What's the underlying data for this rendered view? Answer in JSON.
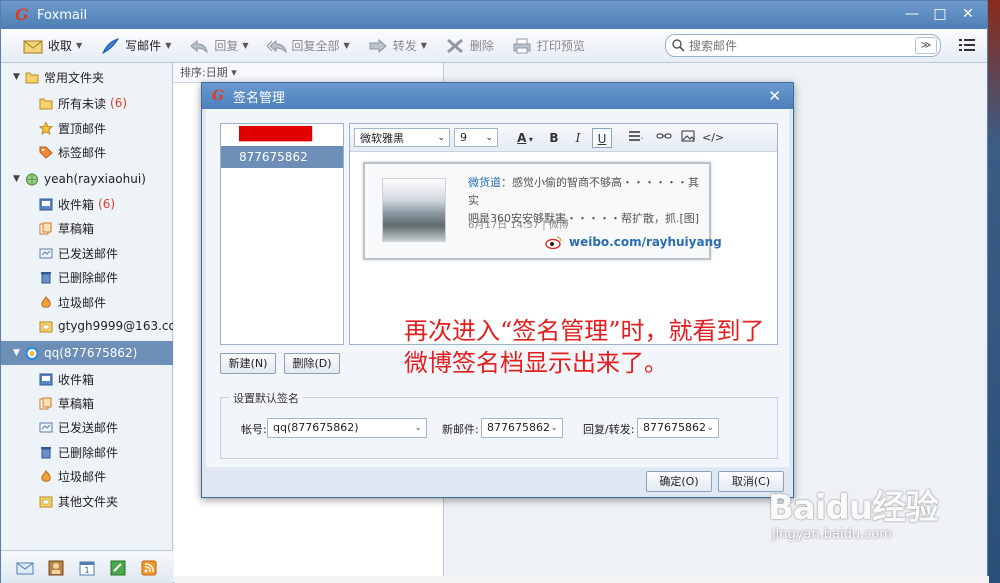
{
  "window": {
    "title": "Foxmail",
    "minimize": "—",
    "maximize": "□",
    "close": "✕"
  },
  "toolbar": {
    "receive": "收取",
    "compose": "写邮件",
    "reply": "回复",
    "reply_all": "回复全部",
    "forward": "转发",
    "delete": "删除",
    "print_preview": "打印预览",
    "search_placeholder": "搜索邮件",
    "search_dropdown": "≫"
  },
  "sidebar": {
    "favorites": {
      "label": "常用文件夹",
      "items": [
        {
          "label": "所有未读",
          "count": "(6)"
        },
        {
          "label": "置顶邮件",
          "count": ""
        },
        {
          "label": "标签邮件",
          "count": ""
        }
      ]
    },
    "account1": {
      "label": "yeah(rayxiaohui)",
      "items": [
        {
          "label": "收件箱",
          "count": "(6)"
        },
        {
          "label": "草稿箱",
          "count": ""
        },
        {
          "label": "已发送邮件",
          "count": ""
        },
        {
          "label": "已删除邮件",
          "count": ""
        },
        {
          "label": "垃圾邮件",
          "count": ""
        },
        {
          "label": "gtygh9999@163.co...",
          "count": ""
        }
      ]
    },
    "account2": {
      "label": "qq(877675862)",
      "items": [
        {
          "label": "收件箱"
        },
        {
          "label": "草稿箱"
        },
        {
          "label": "已发送邮件"
        },
        {
          "label": "已删除邮件"
        },
        {
          "label": "垃圾邮件"
        },
        {
          "label": "其他文件夹"
        }
      ]
    }
  },
  "list": {
    "sort_label": "排序:日期 ▾"
  },
  "dialog": {
    "title": "签名管理",
    "close": "✕",
    "signatures": [
      {
        "label": "████████"
      },
      {
        "label": "877675862"
      }
    ],
    "editor": {
      "font": "微软雅黑",
      "size": "9",
      "bold": "B",
      "italic": "I",
      "underline": "U",
      "card": {
        "author": "微货道",
        "text_part1": "：感觉小偷的智商不够高・・・・・・其实",
        "text_part2": "吧是360安安够默害・・・・・帮扩散，抓.[图]",
        "meta": "6月17日  14:57 | 微博",
        "link": "weibo.com/rayhuiyang"
      }
    },
    "new_button": "新建(N)",
    "delete_button": "删除(D)",
    "default_group": {
      "legend": "设置默认签名",
      "account_label": "帐号:",
      "account_value": "qq(877675862)",
      "new_mail_label": "新邮件:",
      "new_mail_value": "877675862",
      "reply_label": "回复/转发:",
      "reply_value": "877675862"
    },
    "ok_button": "确定(O)",
    "cancel_button": "取消(C)"
  },
  "annotation": {
    "line1": "再次进入“签名管理”时，就看到了",
    "line2": "微博签名档显示出来了。"
  },
  "watermark": {
    "logo": "Baidu经验",
    "sub": "jingyan.baidu.com"
  },
  "colors": {
    "accent": "#4d7eb4",
    "selection": "#6d8fb7",
    "annotation": "#e41e1e",
    "count": "#e03a2a"
  }
}
